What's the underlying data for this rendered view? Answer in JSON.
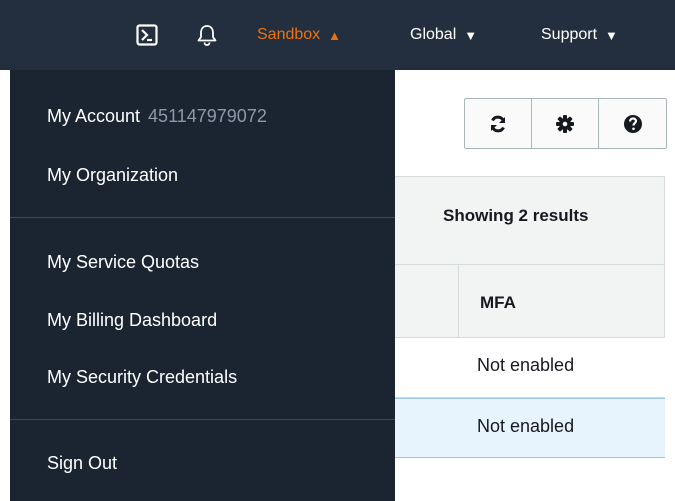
{
  "topbar": {
    "cloudshell_icon": "cloudshell-icon",
    "bell_icon": "bell-icon",
    "sandbox_label": "Sandbox",
    "global_label": "Global",
    "support_label": "Support",
    "accent_color": "#ec7211",
    "caret_up": "▲",
    "caret_down": "▼"
  },
  "menu": {
    "account_label": "My Account",
    "account_id": "451147979072",
    "organization_label": "My Organization",
    "service_quotas_label": "My Service Quotas",
    "billing_label": "My Billing Dashboard",
    "security_label": "My Security Credentials",
    "sign_out_label": "Sign Out"
  },
  "toolbar": {
    "icons": [
      "refresh-icon",
      "gear-icon",
      "help-icon"
    ]
  },
  "table": {
    "results_label": "Showing 2 results",
    "mfa_header": "MFA",
    "rows": [
      {
        "mfa": "Not enabled"
      },
      {
        "mfa": "Not enabled"
      }
    ]
  }
}
